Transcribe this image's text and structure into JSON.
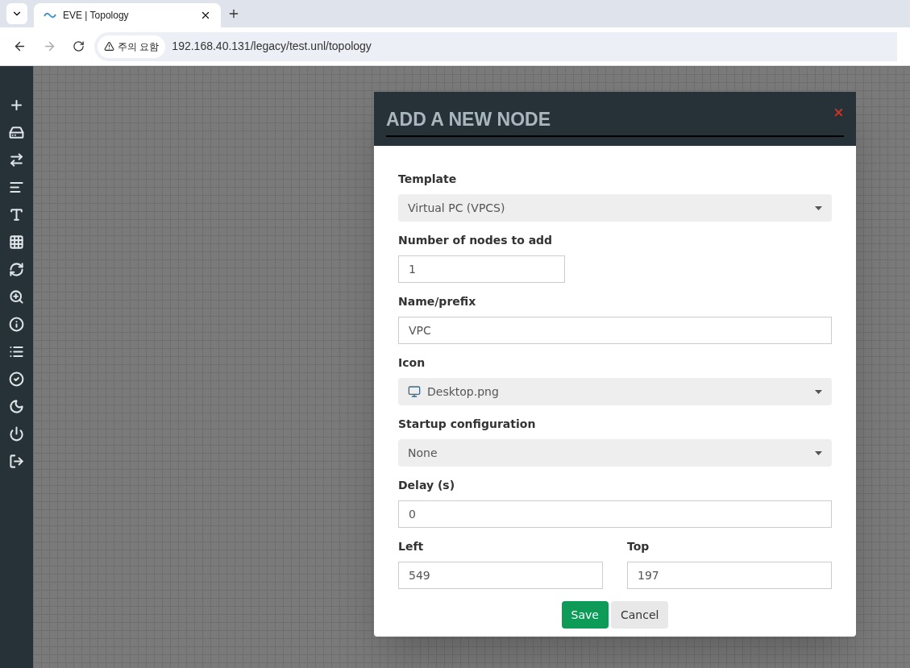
{
  "browser": {
    "tabs": [
      {
        "title": "EVE | Topology",
        "selected": true
      }
    ],
    "security_chip": "주의 요함",
    "url": "192.168.40.131/legacy/test.unl/topology"
  },
  "dialog": {
    "title": "ADD A NEW NODE",
    "fields": [
      {
        "kind": "select",
        "label": "Template",
        "value": "Virtual PC (VPCS)"
      },
      {
        "kind": "input",
        "label": "Number of nodes to add",
        "value": "1",
        "narrow": true
      },
      {
        "kind": "input",
        "label": "Name/prefix",
        "value": "VPC"
      },
      {
        "kind": "select",
        "label": "Icon",
        "value": "Desktop.png",
        "has_icon": true
      },
      {
        "kind": "select",
        "label": "Startup configuration",
        "value": "None"
      },
      {
        "kind": "input",
        "label": "Delay (s)",
        "value": "0"
      }
    ],
    "position": [
      {
        "label": "Left",
        "value": "549"
      },
      {
        "label": "Top",
        "value": "197"
      }
    ],
    "buttons": [
      {
        "label": "Save",
        "kind": "primary"
      },
      {
        "label": "Cancel",
        "kind": "secondary"
      }
    ]
  }
}
